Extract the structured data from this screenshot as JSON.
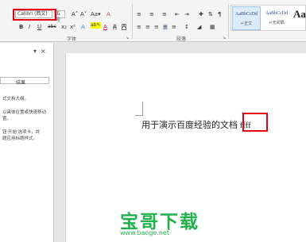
{
  "ribbon": {
    "font_name": "Calibri (西文)",
    "font_size": "五号",
    "grow_font": "A˄",
    "shrink_font": "A˅",
    "change_case": "Aa▾",
    "clear_format": "A",
    "bold": "B",
    "italic": "I",
    "underline": "U",
    "strikethrough": "abc",
    "subscript": "x₂",
    "superscript": "x²",
    "font_color": "A",
    "highlight": "ab✎",
    "char_shading": "A",
    "font_group_label": "字体",
    "paragraph_group_label": "段落",
    "styles": {
      "style1_preview": "AaBbCcDd",
      "style1_name": "↵正文",
      "style2_preview": "AaBbCcDd",
      "style2_name": "↵无间隔",
      "style3_preview": "Aa"
    }
  },
  "nav": {
    "close": "×",
    "dropdown": "▾",
    "tab_results": "结果",
    "lines": [
      "式文档大纲。",
      "以具体位置或快速移动",
      "置。",
      "钮'开始'选项卡，并",
      "题应用标题样式。"
    ]
  },
  "document": {
    "line_text": "用于演示百度经验的文档 ffff"
  },
  "watermark": {
    "brand": "宝哥下载",
    "url": "www.baoge.net"
  },
  "colors": {
    "highlight_red": "#e60012",
    "watermark_green": "#22b14c",
    "font_color_red": "#e60012",
    "highlight_yellow": "#ffff00"
  }
}
